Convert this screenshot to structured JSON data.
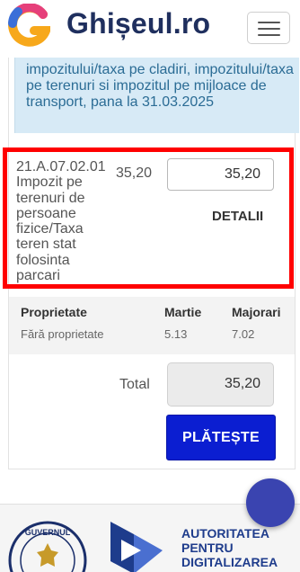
{
  "header": {
    "brand": "Ghișeul.ro",
    "logo_icon": "ghiseul-logo-icon",
    "menu_icon": "hamburger-menu-icon"
  },
  "info": {
    "text": "impozitului/taxa pe cladiri, impozitului/taxa pe terenuri si impozitul pe mijloace de transport, pana la 31.03.2025"
  },
  "tax_row": {
    "code": "21.A.07.02.01 Impozit pe terenuri de persoane fizice/Taxa teren stat folosinta parcari",
    "amount": "35,20",
    "input_value": "35,20",
    "details_label": "DETALII"
  },
  "property": {
    "headers": [
      "Proprietate",
      "Martie",
      "Majorari"
    ],
    "values": [
      "Fără proprietate",
      "5.13",
      "7.02"
    ]
  },
  "total": {
    "label": "Total",
    "value": "35,20"
  },
  "pay_button": "PLĂTEȘTE",
  "footer": {
    "gov_seal": "guvernul-romaniei-seal",
    "gov_seal_text": "GUVERNUL",
    "adr_lines": [
      "AUTORITATEA",
      "PENTRU",
      "DIGITALIZAREA"
    ]
  },
  "colors": {
    "brand": "#1f2f5e",
    "info_bg": "#d7eaf6",
    "info_text": "#2b6c95",
    "highlight": "#ff0000",
    "pay_button": "#0b1ed1",
    "chat": "#3a44b0"
  },
  "chat_icon": "chat-bubble-icon"
}
